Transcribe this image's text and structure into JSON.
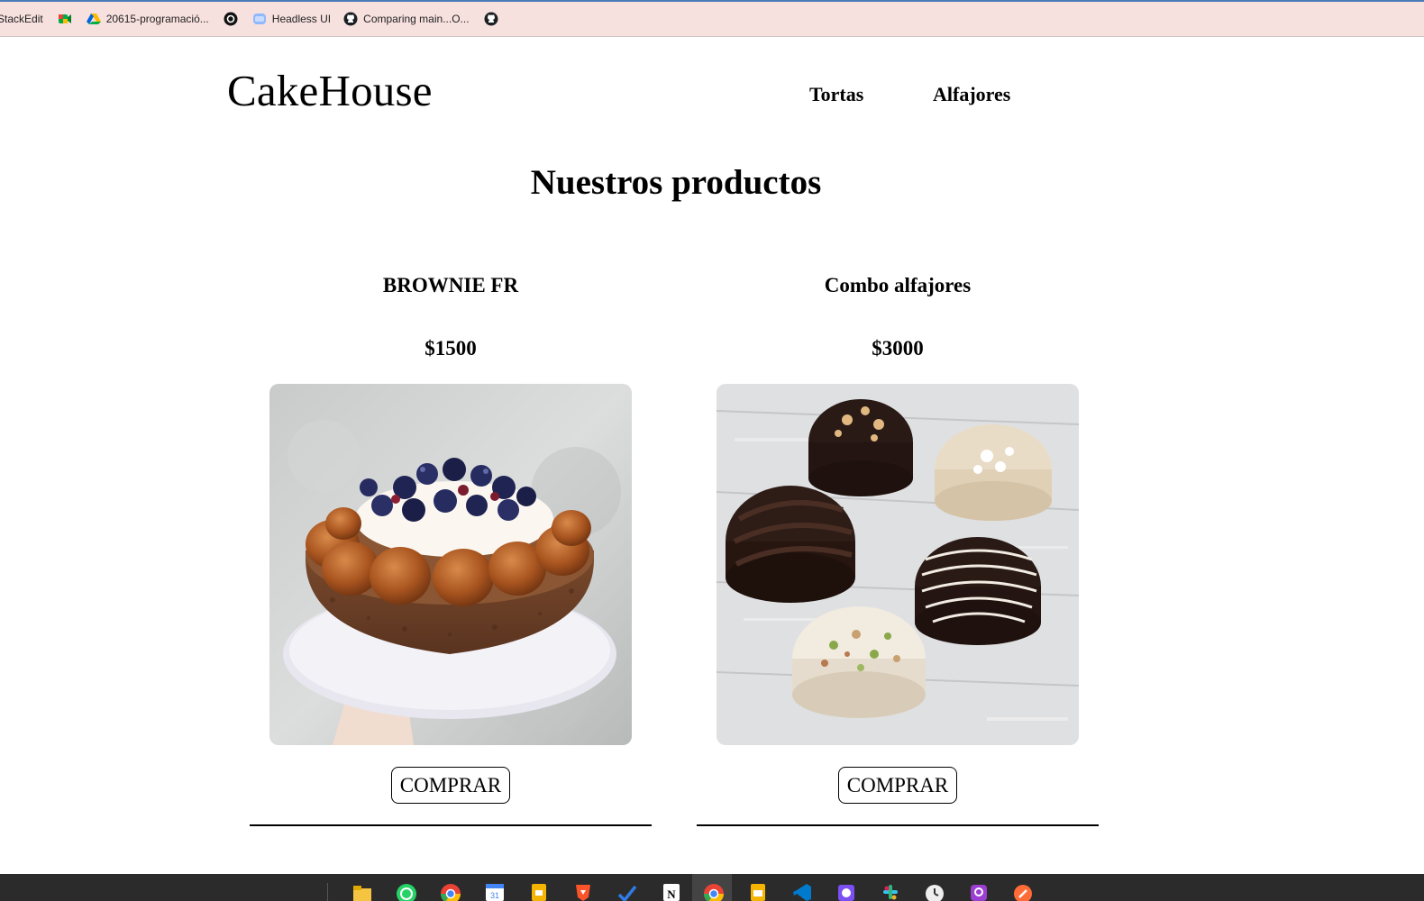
{
  "bookmarks": [
    {
      "label": "StackEdit",
      "icon": "stackedit-icon"
    },
    {
      "label": "",
      "icon": "google-meet-icon"
    },
    {
      "label": "20615-programació...",
      "icon": "google-drive-icon"
    },
    {
      "label": "",
      "icon": "threads-icon"
    },
    {
      "label": "Headless UI",
      "icon": "headless-ui-icon"
    },
    {
      "label": "Comparing main...O...",
      "icon": "github-icon"
    },
    {
      "label": "",
      "icon": "github-icon"
    }
  ],
  "site": {
    "logo": "CakeHouse",
    "nav": [
      "Tortas",
      "Alfajores"
    ],
    "title": "Nuestros productos"
  },
  "products": [
    {
      "name": "BROWNIE FR",
      "price": "$1500",
      "button": "COMPRAR",
      "image": "brownie-cake-photo"
    },
    {
      "name": "Combo alfajores",
      "price": "$3000",
      "button": "COMPRAR",
      "image": "alfajores-photo"
    }
  ],
  "taskbar": {
    "apps": [
      "file-explorer-icon",
      "whatsapp-icon",
      "chrome-icon",
      "calendar-icon",
      "drive-icon",
      "brave-icon",
      "vscode-check-icon",
      "notion-icon",
      "chrome-active-icon",
      "slides-icon",
      "vscode-icon",
      "github-desktop-icon",
      "slack-icon",
      "clock-icon",
      "podcast-icon",
      "postman-icon"
    ]
  }
}
